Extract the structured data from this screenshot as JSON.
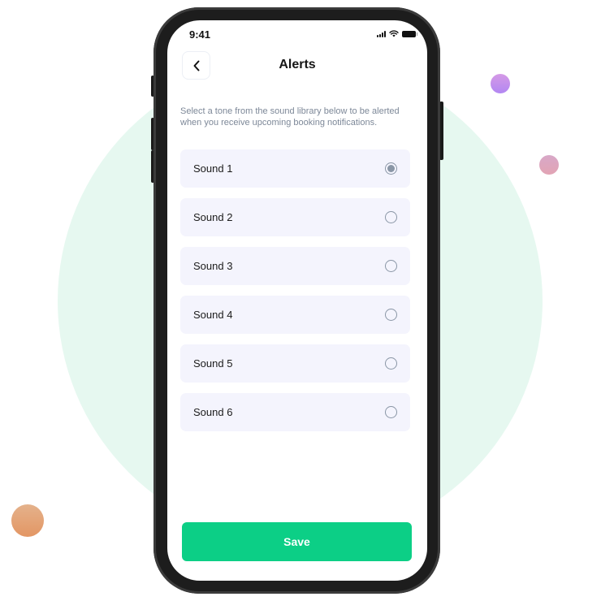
{
  "status_bar": {
    "time": "9:41"
  },
  "header": {
    "title": "Alerts",
    "back_icon": "chevron-left-icon"
  },
  "description": "Select a tone from the sound library below to be alerted when you receive upcoming booking notifications.",
  "sounds": [
    {
      "label": "Sound 1",
      "selected": true
    },
    {
      "label": "Sound 2",
      "selected": false
    },
    {
      "label": "Sound 3",
      "selected": false
    },
    {
      "label": "Sound 4",
      "selected": false
    },
    {
      "label": "Sound 5",
      "selected": false
    },
    {
      "label": "Sound 6",
      "selected": false
    }
  ],
  "save_button": {
    "label": "Save"
  },
  "colors": {
    "accent": "#0ccf86",
    "item_background": "#f4f4fd",
    "background_circle": "#e6f8f0",
    "radio": "#8a96a6"
  }
}
